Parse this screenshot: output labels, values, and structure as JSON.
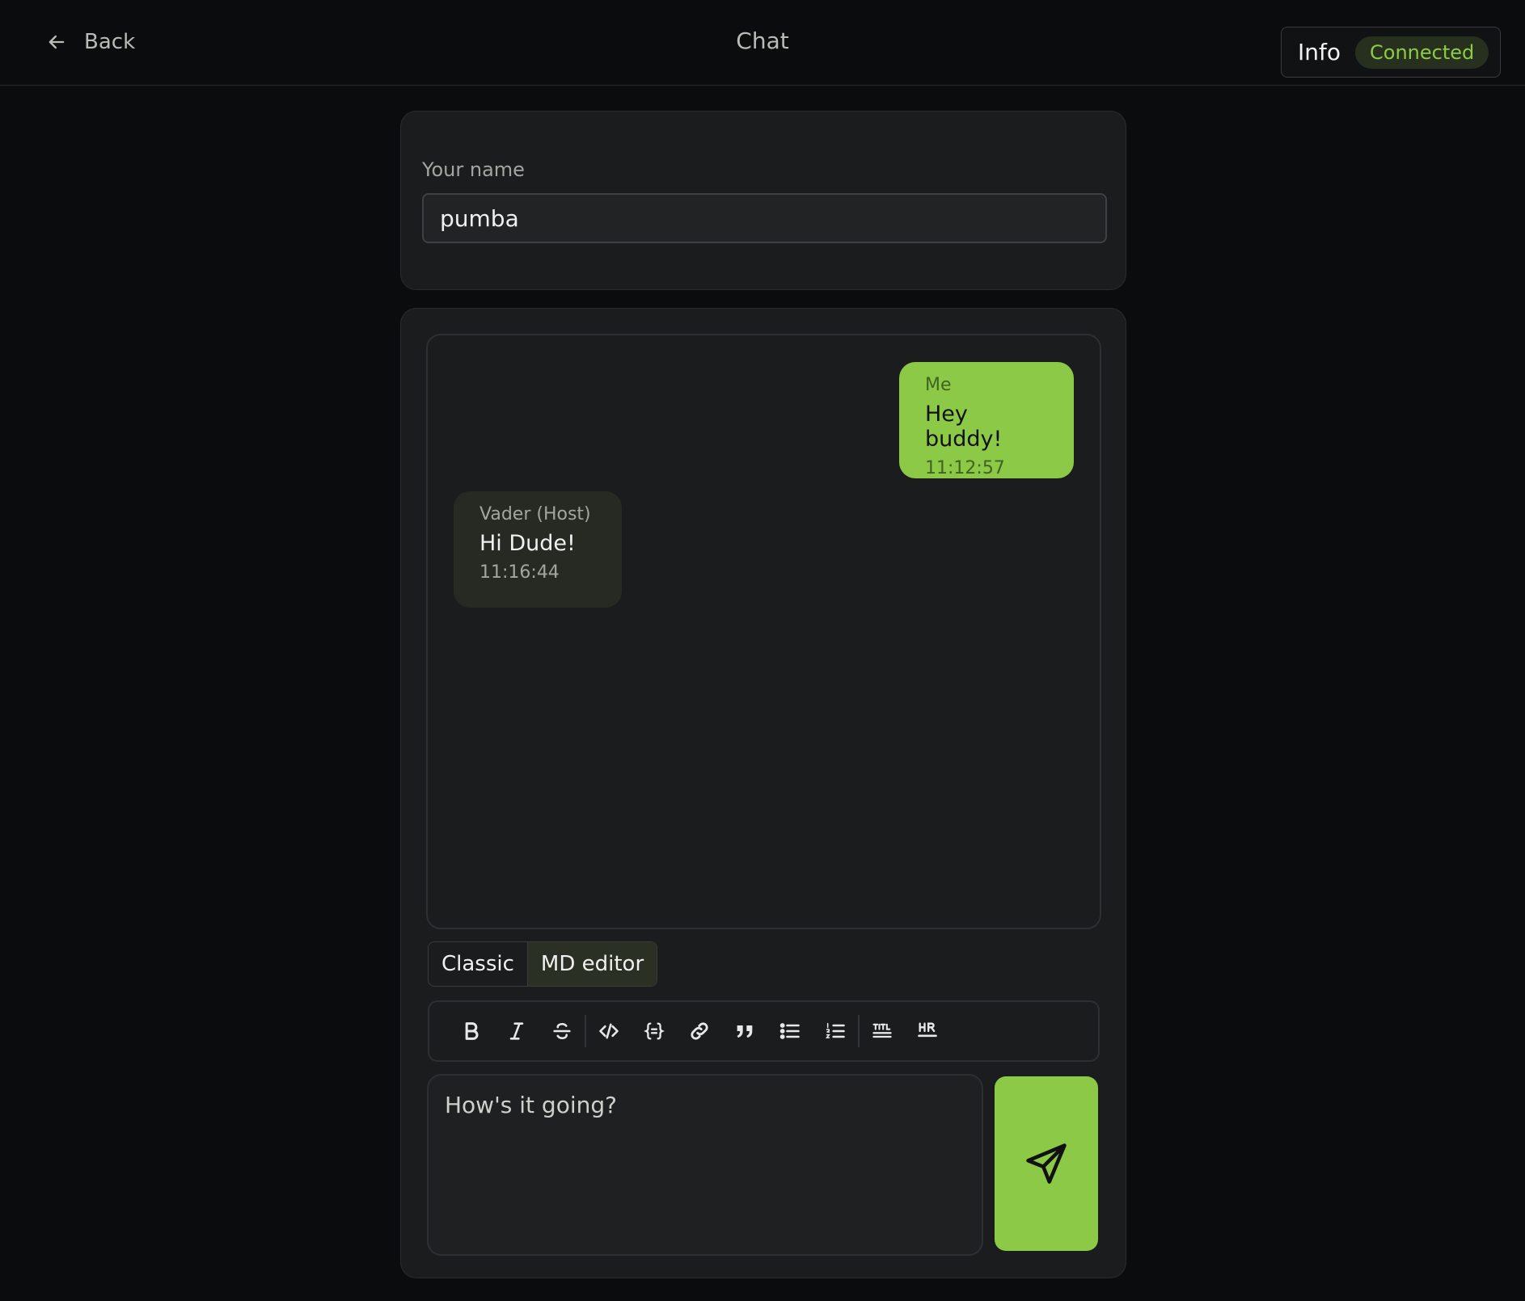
{
  "header": {
    "back_label": "Back",
    "title": "Chat",
    "info_label": "Info",
    "status": "Connected"
  },
  "profile": {
    "name_label": "Your name",
    "name_value": "pumba"
  },
  "messages": [
    {
      "sender": "Me",
      "text": "Hey buddy!",
      "time": "11:12:57"
    },
    {
      "sender": "Vader (Host)",
      "text": "Hi Dude!",
      "time": "11:16:44"
    }
  ],
  "editor": {
    "modes": [
      "Classic",
      "MD editor"
    ],
    "active_mode": "MD editor",
    "toolbar": [
      "bold-icon",
      "italic-icon",
      "strikethrough-icon",
      "code-icon",
      "code-block-icon",
      "link-icon",
      "quote-icon",
      "bullet-list-icon",
      "ordered-list-icon",
      "title-icon",
      "horizontal-rule-icon"
    ],
    "composer_value": "How's it going?"
  },
  "colors": {
    "accent": "#8cc946",
    "background": "#0b0c0e",
    "card": "#1b1c1e"
  }
}
